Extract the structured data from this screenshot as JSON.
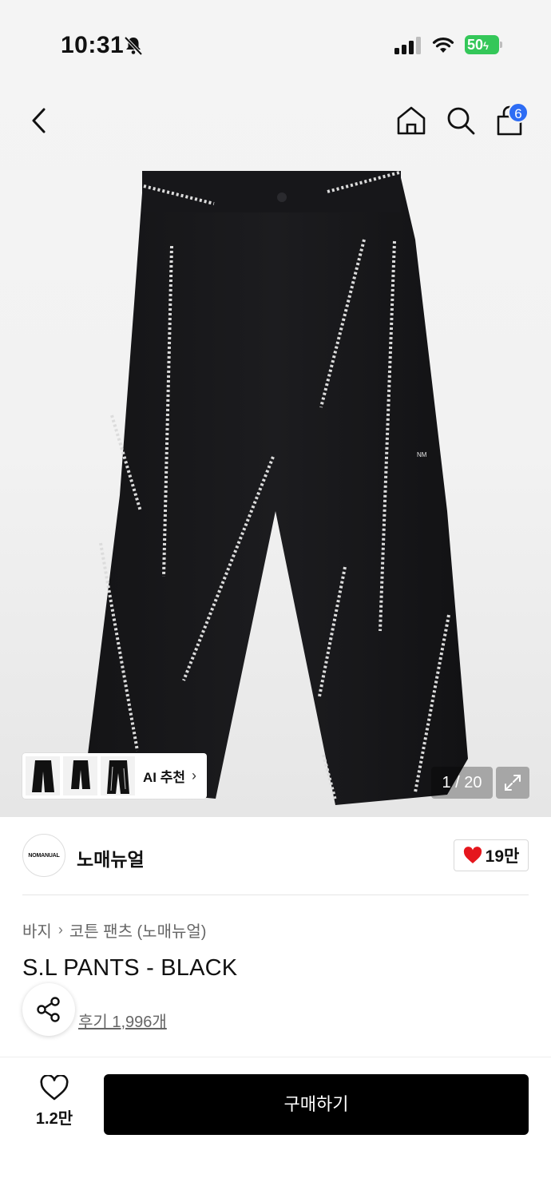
{
  "status_bar": {
    "time": "10:31",
    "battery": "50"
  },
  "nav": {
    "cart_count": "6"
  },
  "gallery": {
    "ai_label": "AI 추천",
    "counter": "1 / 20"
  },
  "product_logo_text": "NM",
  "brand": {
    "name": "노매뉴얼",
    "logo_text": "NOMANUAL",
    "likes": "19만"
  },
  "breadcrumb": {
    "category": "바지",
    "subcategory": "코튼 팬츠 (노매뉴얼)"
  },
  "product": {
    "title": "S.L PANTS - BLACK",
    "reviews": "후기 1,996개"
  },
  "bottom_bar": {
    "wish_count": "1.2만",
    "buy_label": "구매하기"
  },
  "colors": {
    "accent": "#2d6cf4",
    "heart": "#e5161d",
    "battery": "#34c759",
    "buy": "#000000"
  }
}
